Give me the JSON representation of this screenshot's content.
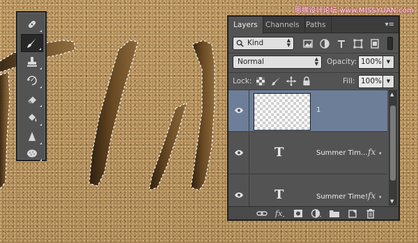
{
  "watermark": "思缘设计论坛 www.MISSYUAN.com",
  "tools": [
    {
      "name": "spot-healing-brush-icon",
      "active": false
    },
    {
      "name": "brush-icon",
      "active": true
    },
    {
      "name": "clone-stamp-icon",
      "active": false
    },
    {
      "name": "history-brush-icon",
      "active": false
    },
    {
      "name": "eraser-icon",
      "active": false
    },
    {
      "name": "paint-bucket-icon",
      "active": false
    },
    {
      "name": "sharpen-icon",
      "active": false
    },
    {
      "name": "sponge-icon",
      "active": false
    }
  ],
  "panel": {
    "tabs": [
      {
        "label": "Layers",
        "active": true
      },
      {
        "label": "Channels",
        "active": false
      },
      {
        "label": "Paths",
        "active": false
      }
    ],
    "filter": {
      "kind": "Kind"
    },
    "blend_mode": "Normal",
    "opacity_label": "Opacity:",
    "opacity_value": "100%",
    "lock_label": "Lock:",
    "fill_label": "Fill:",
    "fill_value": "100%",
    "layers": [
      {
        "name": "1",
        "type": "pixel",
        "selected": true,
        "visible": true
      },
      {
        "name": "Summer Tim...",
        "type": "text",
        "selected": false,
        "visible": true,
        "fx": "fx"
      },
      {
        "name": "Summer Time!",
        "type": "text",
        "selected": false,
        "visible": true,
        "fx": "fx"
      }
    ]
  },
  "colors": {
    "panel_bg": "#535353",
    "selected_layer": "#6d7e99",
    "sand": "#b38c57"
  }
}
